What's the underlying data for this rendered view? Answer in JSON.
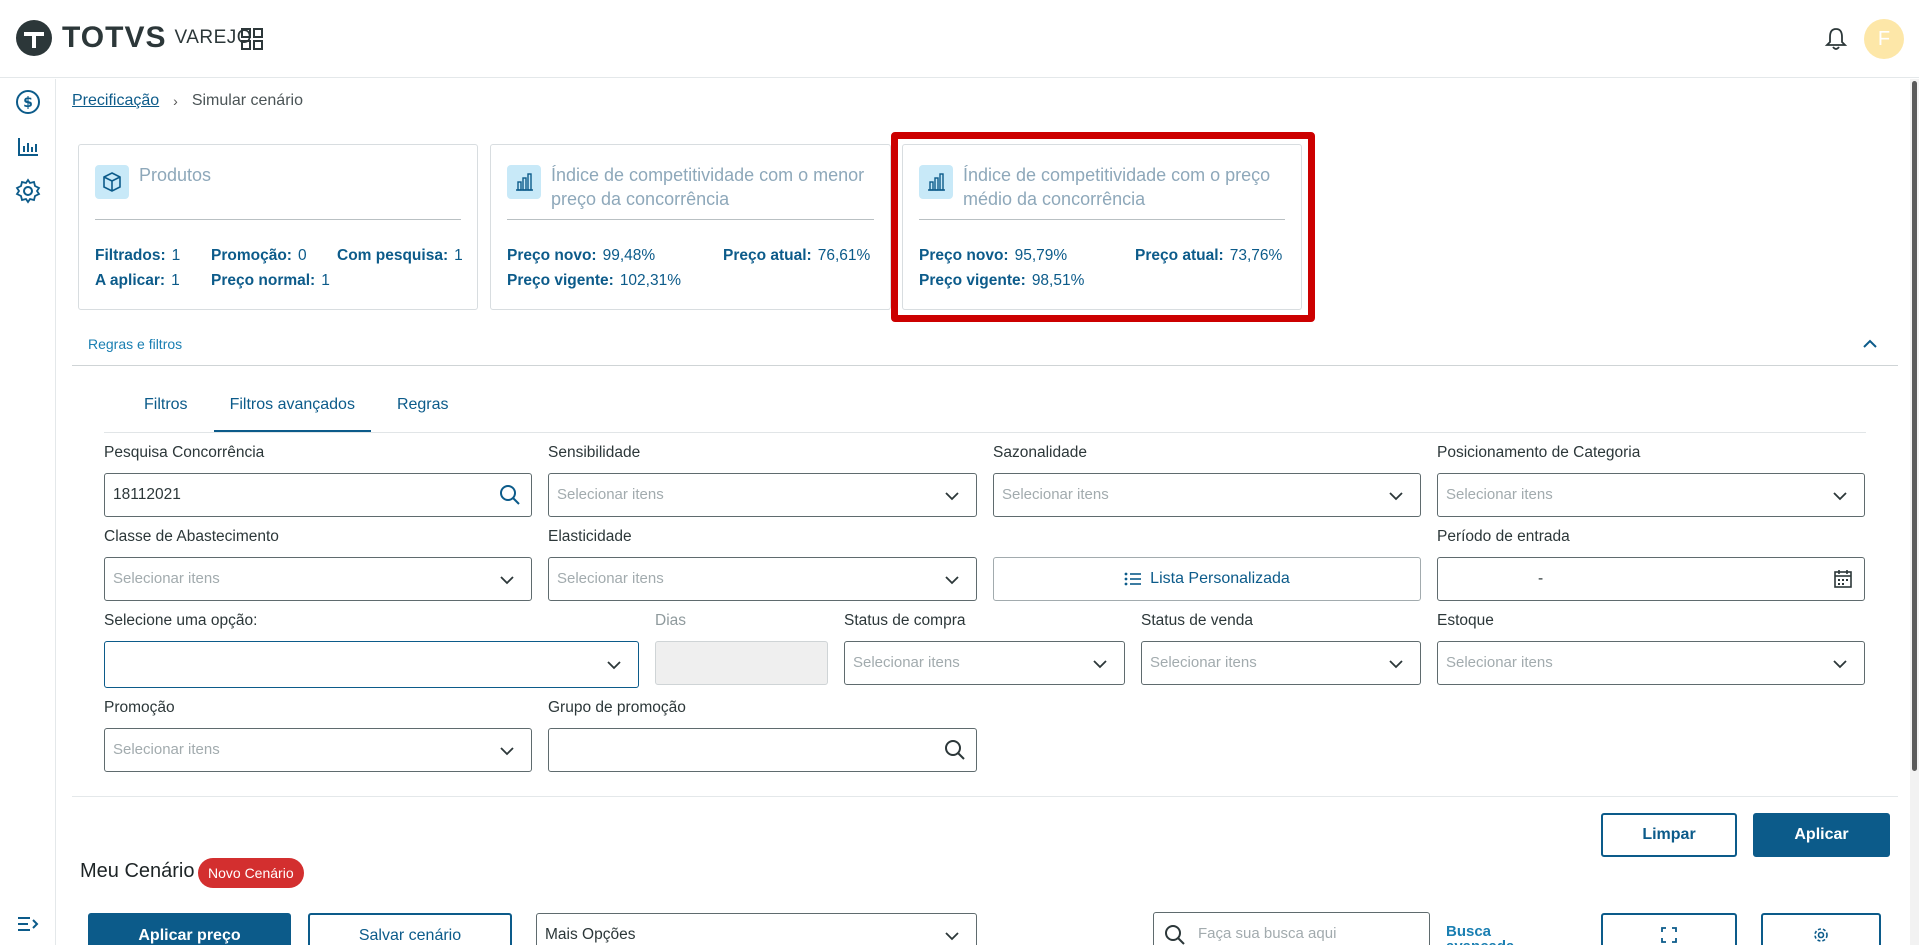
{
  "header": {
    "logo_text": "TOTVS",
    "logo_sub": "VAREJO",
    "avatar_initial": "F"
  },
  "breadcrumb": {
    "link": "Precificação",
    "current": "Simular cenário"
  },
  "cards": {
    "produtos": {
      "title": "Produtos",
      "filtrados_label": "Filtrados:",
      "filtrados_value": "1",
      "promocao_label": "Promoção:",
      "promocao_value": "0",
      "com_pesquisa_label": "Com pesquisa:",
      "com_pesquisa_value": "1",
      "a_aplicar_label": "A aplicar:",
      "a_aplicar_value": "1",
      "preco_normal_label": "Preço normal:",
      "preco_normal_value": "1"
    },
    "menor": {
      "title_line1": "Índice de competitividade com o menor",
      "title_line2": "preço da concorrência",
      "novo_label": "Preço novo:",
      "novo_value": "99,48%",
      "atual_label": "Preço atual:",
      "atual_value": "76,61%",
      "vigente_label": "Preço vigente:",
      "vigente_value": "102,31%"
    },
    "medio": {
      "title_line1": "Índice de competitividade com o preço",
      "title_line2": "médio da concorrência",
      "novo_label": "Preço novo:",
      "novo_value": "95,79%",
      "atual_label": "Preço atual:",
      "atual_value": "73,76%",
      "vigente_label": "Preço vigente:",
      "vigente_value": "98,51%"
    }
  },
  "filters_section": {
    "title": "Regras e filtros",
    "tabs": [
      "Filtros",
      "Filtros avançados",
      "Regras"
    ],
    "active_tab": "Filtros avançados"
  },
  "fields": {
    "pesquisa_label": "Pesquisa Concorrência",
    "pesquisa_value": "18112021",
    "sensibilidade_label": "Sensibilidade",
    "sazonalidade_label": "Sazonalidade",
    "posicionamento_label": "Posicionamento de Categoria",
    "classe_label": "Classe de Abastecimento",
    "elasticidade_label": "Elasticidade",
    "lista_button": "Lista Personalizada",
    "periodo_label": "Período de entrada",
    "periodo_value": "-",
    "opcao_label": "Selecione uma opção:",
    "dias_label": "Dias",
    "status_compra_label": "Status de compra",
    "status_venda_label": "Status de venda",
    "estoque_label": "Estoque",
    "promocao_label": "Promoção",
    "grupo_label": "Grupo de promoção",
    "placeholder": "Selecionar itens"
  },
  "actions": {
    "limpar": "Limpar",
    "aplicar": "Aplicar"
  },
  "scenario": {
    "title": "Meu Cenário",
    "badge": "Novo Cenário",
    "aplicar_preco": "Aplicar preço",
    "salvar": "Salvar cenário",
    "mais_opcoes": "Mais Opções",
    "search_placeholder": "Faça sua busca aqui",
    "busca_avancada": "Busca avançada"
  },
  "colors": {
    "primary": "#0c5b8a",
    "highlight": "#cc0000",
    "badge": "#d32f2f"
  }
}
